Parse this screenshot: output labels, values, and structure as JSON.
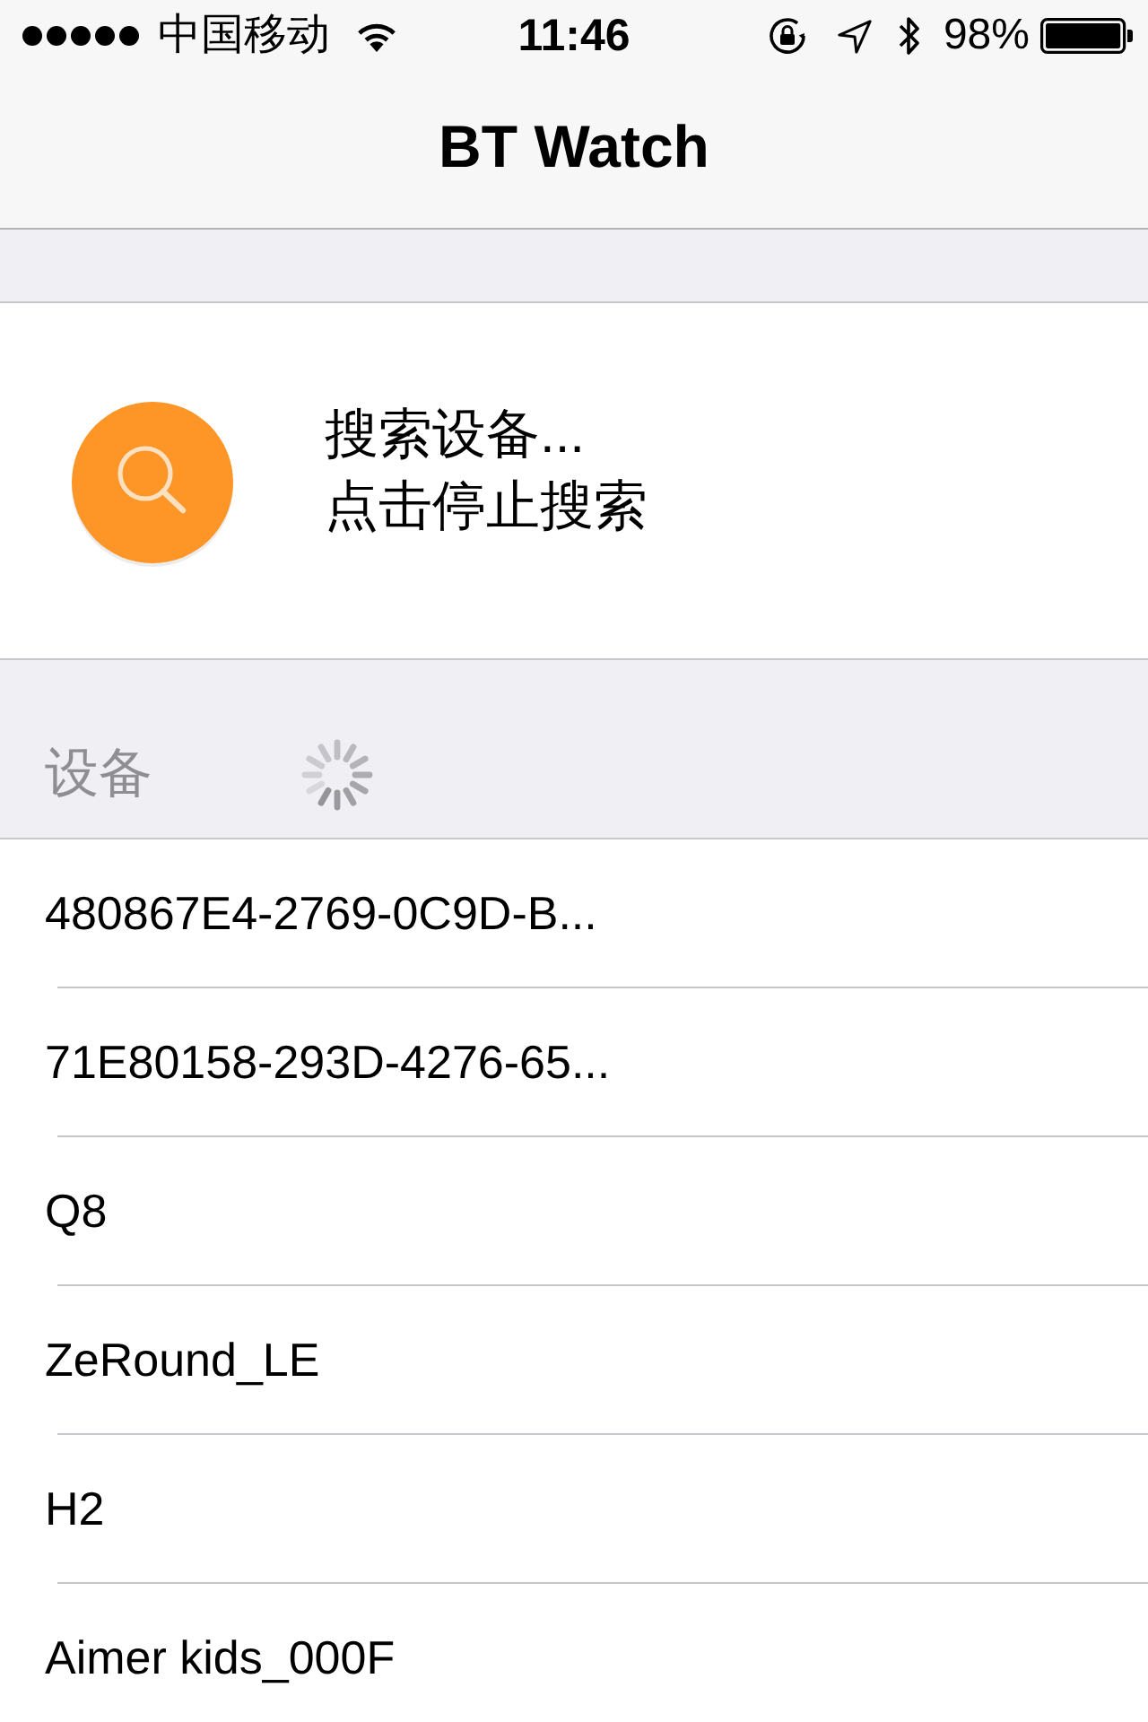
{
  "status_bar": {
    "carrier": "中国移动",
    "time": "11:46",
    "battery": "98%"
  },
  "nav": {
    "title": "BT Watch"
  },
  "search": {
    "status": "搜索设备...",
    "hint": "点击停止搜索"
  },
  "devices": {
    "header": "设备",
    "loading": true,
    "items": [
      {
        "name": "480867E4-2769-0C9D-B..."
      },
      {
        "name": "71E80158-293D-4276-65..."
      },
      {
        "name": "Q8"
      },
      {
        "name": "ZeRound_LE"
      },
      {
        "name": "H2"
      },
      {
        "name": "Aimer kids_000F"
      }
    ]
  }
}
